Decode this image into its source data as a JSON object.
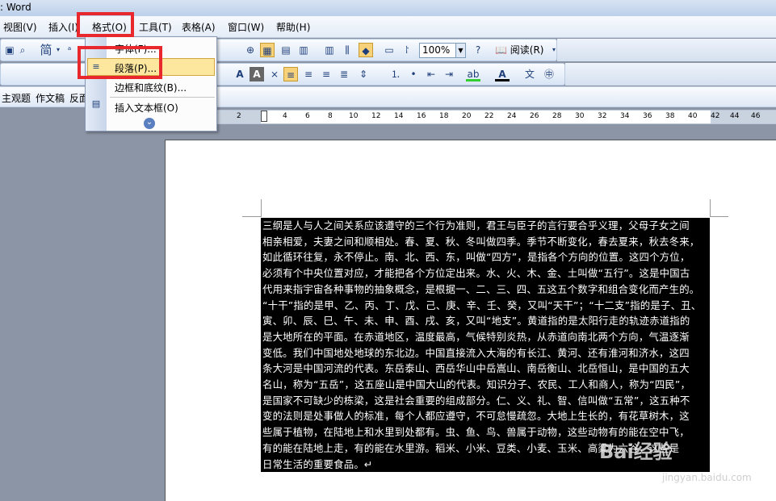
{
  "title": ": Word",
  "menu": [
    {
      "label": "视图(V)",
      "name": "menu-view"
    },
    {
      "label": "插入(I)",
      "name": "menu-insert"
    },
    {
      "label": "格式(O)",
      "name": "menu-format"
    },
    {
      "label": "工具(T)",
      "name": "menu-tools"
    },
    {
      "label": "表格(A)",
      "name": "menu-table"
    },
    {
      "label": "窗口(W)",
      "name": "menu-window"
    },
    {
      "label": "帮助(H)",
      "name": "menu-help"
    }
  ],
  "toolbar": {
    "font_char": "简",
    "zoom": "100%",
    "read_label": "阅读(R)"
  },
  "format_menu": {
    "items": [
      {
        "label": "字体(F)...",
        "name": "menu-item-font"
      },
      {
        "label": "段落(P)...",
        "name": "menu-item-paragraph"
      },
      {
        "label": "边框和底纹(B)...",
        "name": "menu-item-borders"
      },
      {
        "label": "插入文本框(O)",
        "name": "menu-item-textbox"
      }
    ],
    "expand_glyph": "⌄"
  },
  "tabs": [
    "主观题",
    "作文稿",
    "反面"
  ],
  "ruler_numbers": [
    "2",
    "2",
    "4",
    "6",
    "8",
    "10",
    "12",
    "14",
    "16",
    "18",
    "20",
    "22",
    "24",
    "26",
    "28",
    "30",
    "32",
    "34",
    "36",
    "38",
    "40",
    "42",
    "44",
    "46"
  ],
  "document_lines": [
    "三纲是人与人之间关系应该遵守的三个行为准则，君王与臣子的言行要合乎义理，父母子女之间",
    "相亲相爱，夫妻之间和顺相处。春、夏、秋、冬叫做四季。季节不断变化，春去夏来，秋去冬来，",
    "如此循环往复，永不停止。南、北、西、东，叫做“四方”，是指各个方向的位置。这四个方位，",
    "必须有个中央位置对应，才能把各个方位定出来。水、火、木、金、土叫做“五行”。这是中国古",
    "代用来指宇宙各种事物的抽象概念，是根据一、二、三、四、五这五个数字和组合变化而产生的。",
    "“十干”指的是甲、乙、丙、丁、戊、己、庚、辛、壬、癸，又叫“天干”；“十二支”指的是子、丑、",
    "寅、卯、辰、巳、午、未、申、酉、戌、亥，又叫“地支”。黄道指的是太阳行走的轨迹赤道指的",
    "是大地所在的平面。在赤道地区，温度最高，气候特别炎热，从赤道向南北两个方向，气温逐渐",
    "变低。我们中国地处地球的东北边。中国直接流入大海的有长江、黄河、还有淮河和济水，这四",
    "条大河是中国河流的代表。东岳泰山、西岳华山中岳嵩山、南岳衡山、北岳恒山，是中国的五大",
    "名山，称为“五岳”，这五座山是中国大山的代表。知识分子、农民、工人和商人，称为“四民”，",
    "是国家不可缺少的栋梁，这是社会重要的组成部分。仁、义、礼、智、信叫做“五常”，这五种不",
    "变的法则是处事做人的标准，每个人都应遵守，不可怠慢疏忽。大地上生长的，有花草树木，这",
    "些属于植物，在陆地上和水里到处都有。虫、鱼、鸟、兽属于动物，这些动物有的能在空中飞，",
    "有的能在陆地上走，有的能在水里游。稻米、小米、豆类、小麦、玉米、高粱为六谷，这些是",
    "日常生活的重要食品。↵"
  ],
  "watermark": {
    "text": "Bai经验",
    "url": "jingyan.baidu.com"
  },
  "colors": {
    "highlight": "#e8282c",
    "menu_hover": "#fde79e",
    "selection": "#000000"
  }
}
